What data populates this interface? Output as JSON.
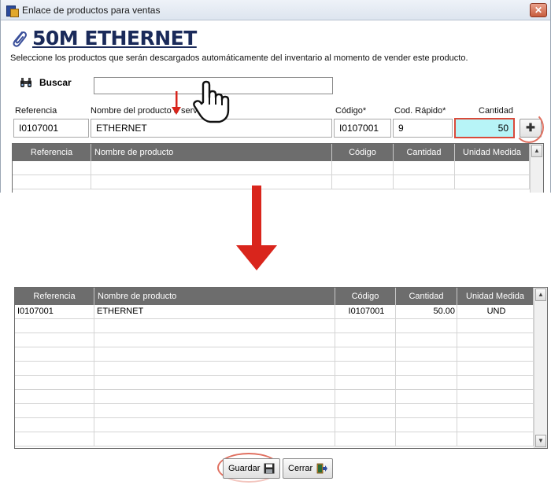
{
  "window": {
    "title": "Enlace de productos para ventas",
    "close_glyph": "✕"
  },
  "heading": {
    "product_name": "50M ETHERNET",
    "subtitle": "Seleccione los productos que serán descargados automáticamente del inventario al momento de vender este producto."
  },
  "search": {
    "label": "Buscar",
    "value": ""
  },
  "form": {
    "labels": {
      "referencia": "Referencia",
      "nombre": "Nombre del producto o servicio",
      "codigo": "Código*",
      "cod_rapido": "Cod. Rápido*",
      "cantidad": "Cantidad"
    },
    "values": {
      "referencia": "I0107001",
      "nombre": "ETHERNET",
      "codigo": "I0107001",
      "cod_rapido": "9",
      "cantidad": "50"
    },
    "add_glyph": "✚"
  },
  "grid": {
    "columns": [
      "Referencia",
      "Nombre de producto",
      "Código",
      "Cantidad",
      "Unidad Medida"
    ],
    "rows": [
      [
        "I0107001",
        "ETHERNET",
        "I0107001",
        "50.00",
        "UND"
      ]
    ]
  },
  "footer": {
    "save_label": "Guardar",
    "close_label": "Cerrar"
  },
  "icons": {
    "app": "app-icon",
    "clip": "paperclip-icon",
    "binoculars": "binoculars-icon",
    "save": "floppy-disk-icon",
    "exit": "exit-door-icon"
  },
  "colors": {
    "quantity_highlight": "#b7f4f7",
    "annotation_red": "#d9251c",
    "grid_header": "#6d6d6d"
  }
}
